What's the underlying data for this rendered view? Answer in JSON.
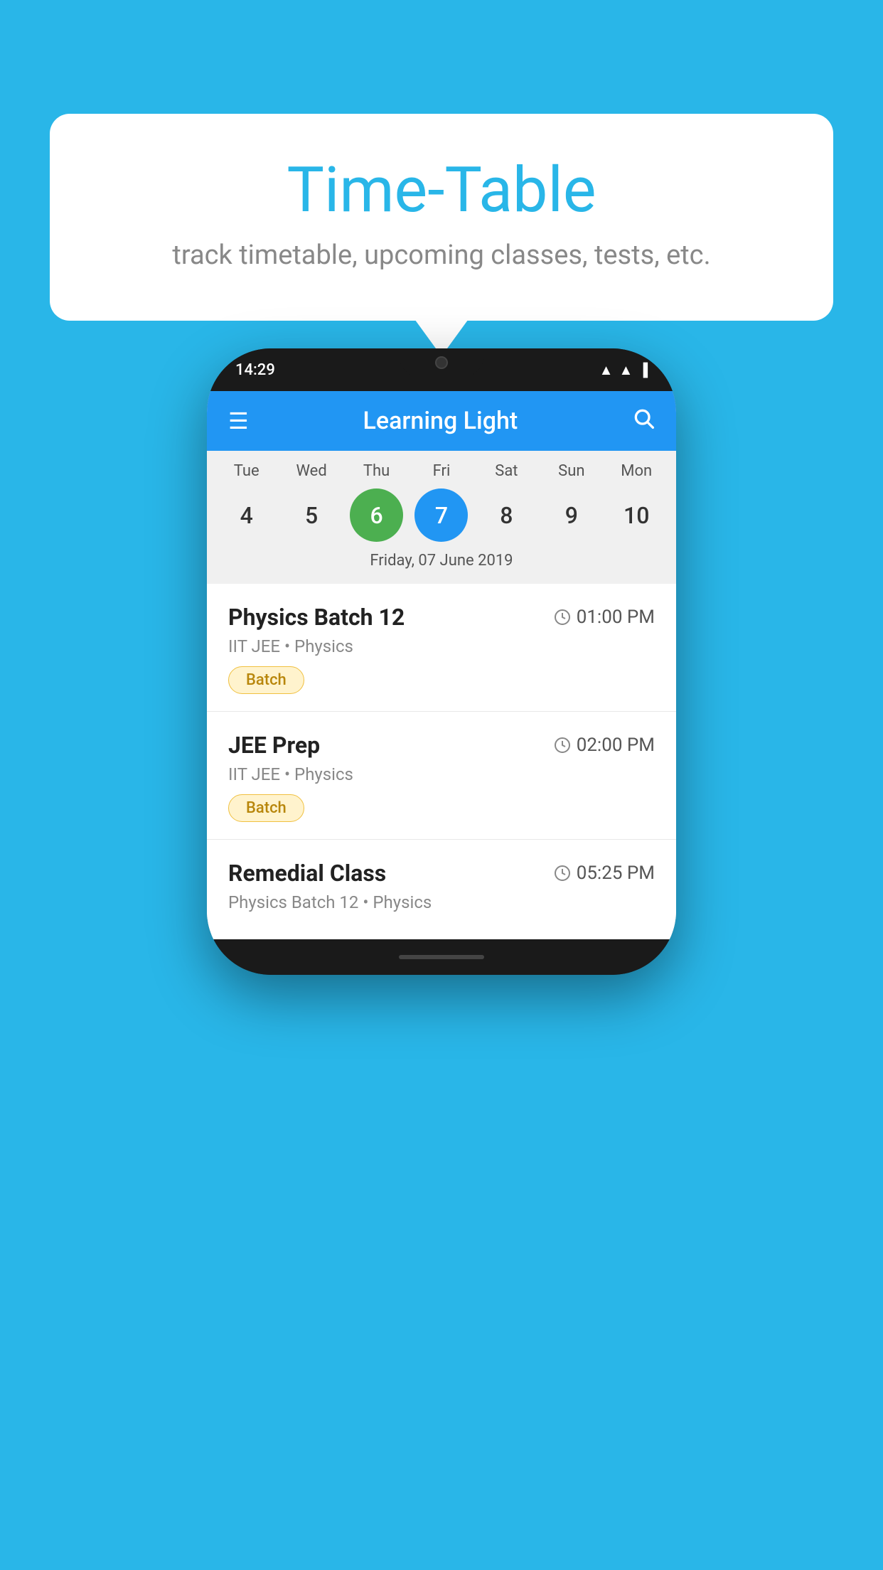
{
  "background_color": "#29b6e8",
  "bubble": {
    "title": "Time-Table",
    "subtitle": "track timetable, upcoming classes, tests, etc."
  },
  "phone": {
    "status_bar": {
      "time": "14:29"
    },
    "app_header": {
      "title": "Learning Light"
    },
    "calendar": {
      "days": [
        {
          "name": "Tue",
          "number": "4",
          "state": "normal"
        },
        {
          "name": "Wed",
          "number": "5",
          "state": "normal"
        },
        {
          "name": "Thu",
          "number": "6",
          "state": "today"
        },
        {
          "name": "Fri",
          "number": "7",
          "state": "selected"
        },
        {
          "name": "Sat",
          "number": "8",
          "state": "normal"
        },
        {
          "name": "Sun",
          "number": "9",
          "state": "normal"
        },
        {
          "name": "Mon",
          "number": "10",
          "state": "normal"
        }
      ],
      "selected_date_label": "Friday, 07 June 2019"
    },
    "classes": [
      {
        "name": "Physics Batch 12",
        "time": "01:00 PM",
        "meta": "IIT JEE • Physics",
        "badge": "Batch"
      },
      {
        "name": "JEE Prep",
        "time": "02:00 PM",
        "meta": "IIT JEE • Physics",
        "badge": "Batch"
      },
      {
        "name": "Remedial Class",
        "time": "05:25 PM",
        "meta": "Physics Batch 12 • Physics",
        "badge": null
      }
    ]
  },
  "labels": {
    "menu_icon": "☰",
    "search_icon": "🔍",
    "clock_icon": "🕐"
  }
}
